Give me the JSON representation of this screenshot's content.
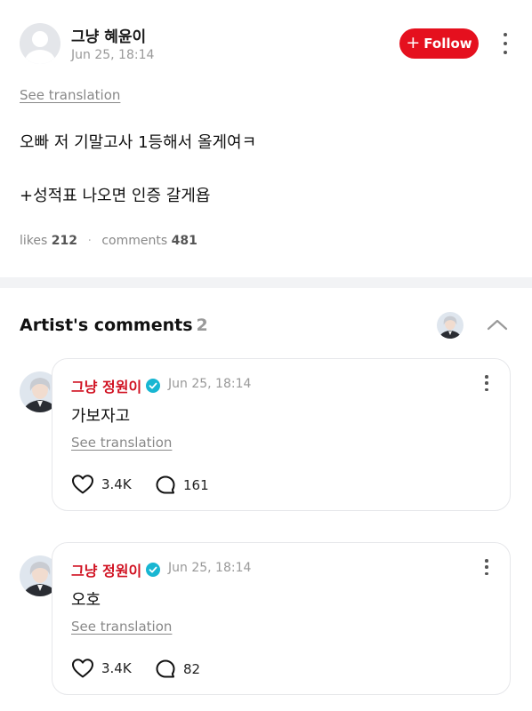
{
  "post": {
    "author": "그냥 혜윤이",
    "time": "Jun 25, 18:14",
    "follow_label": "Follow",
    "see_translation": "See translation",
    "lines": [
      "오빠 저 기말고사 1등해서 올게여ㅋ",
      "+성적표 나오면 인증 갈게욥"
    ],
    "likes_label": "likes",
    "likes_count": "212",
    "comments_label": "comments",
    "comments_count": "481"
  },
  "artist_comments": {
    "title": "Artist's comments",
    "count": "2",
    "items": [
      {
        "name": "그냥 정원이",
        "time": "Jun 25, 18:14",
        "text": "가보자고",
        "see_translation": "See translation",
        "likes": "3.4K",
        "replies": "161"
      },
      {
        "name": "그냥 정원이",
        "time": "Jun 25, 18:14",
        "text": "오호",
        "see_translation": "See translation",
        "likes": "3.4K",
        "replies": "82"
      }
    ]
  },
  "colors": {
    "follow": "#e5101e",
    "artist_name": "#d01020",
    "verified": "#18b6d2"
  },
  "icons": [
    "user-placeholder-icon",
    "plus-icon",
    "kebab-menu-icon",
    "chevron-up-icon",
    "verified-badge-icon",
    "heart-icon",
    "comment-bubble-icon"
  ]
}
